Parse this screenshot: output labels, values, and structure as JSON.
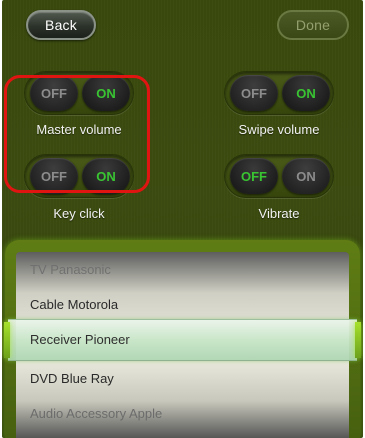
{
  "nav": {
    "back_label": "Back",
    "done_label": "Done"
  },
  "toggles": [
    {
      "label": "Master volume",
      "off": "OFF",
      "on": "ON",
      "state": "on"
    },
    {
      "label": "Swipe volume",
      "off": "OFF",
      "on": "ON",
      "state": "on"
    },
    {
      "label": "Key click",
      "off": "OFF",
      "on": "ON",
      "state": "on"
    },
    {
      "label": "Vibrate",
      "off": "OFF",
      "on": "ON",
      "state": "off"
    }
  ],
  "picker": {
    "items": [
      "TV Panasonic",
      "Cable Motorola",
      "Receiver  Pioneer",
      "DVD Blue Ray",
      "Audio Accessory Apple"
    ],
    "selected": "Receiver  Pioneer"
  },
  "colors": {
    "on_green": "#39c432",
    "highlight_red": "#e01512",
    "background_olive": "#3c4c10"
  }
}
